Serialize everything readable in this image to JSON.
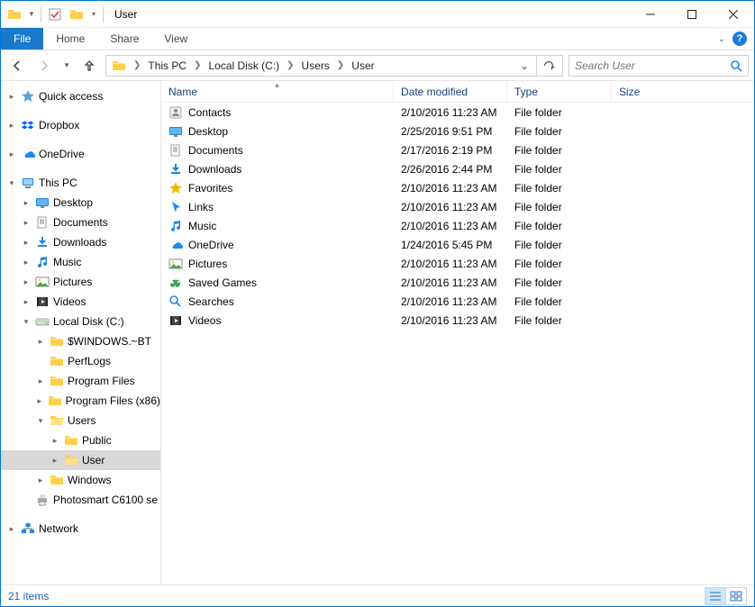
{
  "window": {
    "title": "User"
  },
  "ribbon": {
    "file": "File",
    "tabs": [
      "Home",
      "Share",
      "View"
    ]
  },
  "breadcrumbs": [
    "This PC",
    "Local Disk (C:)",
    "Users",
    "User"
  ],
  "search": {
    "placeholder": "Search User"
  },
  "columns": {
    "name": "Name",
    "date": "Date modified",
    "type": "Type",
    "size": "Size"
  },
  "tree": {
    "quick_access": "Quick access",
    "dropbox": "Dropbox",
    "onedrive": "OneDrive",
    "this_pc": "This PC",
    "desktop": "Desktop",
    "documents": "Documents",
    "downloads": "Downloads",
    "music": "Music",
    "pictures": "Pictures",
    "videos": "Videos",
    "local_disk": "Local Disk (C:)",
    "windows_bt": "$WINDOWS.~BT",
    "perflogs": "PerfLogs",
    "program_files": "Program Files",
    "program_files_x86": "Program Files (x86)",
    "users": "Users",
    "public": "Public",
    "user": "User",
    "windows": "Windows",
    "photosmart": "Photosmart C6100 se",
    "network": "Network"
  },
  "items": [
    {
      "name": "Contacts",
      "date": "2/10/2016 11:23 AM",
      "type": "File folder",
      "icon": "contacts"
    },
    {
      "name": "Desktop",
      "date": "2/25/2016 9:51 PM",
      "type": "File folder",
      "icon": "desktop"
    },
    {
      "name": "Documents",
      "date": "2/17/2016 2:19 PM",
      "type": "File folder",
      "icon": "documents"
    },
    {
      "name": "Downloads",
      "date": "2/26/2016 2:44 PM",
      "type": "File folder",
      "icon": "downloads"
    },
    {
      "name": "Favorites",
      "date": "2/10/2016 11:23 AM",
      "type": "File folder",
      "icon": "favorites"
    },
    {
      "name": "Links",
      "date": "2/10/2016 11:23 AM",
      "type": "File folder",
      "icon": "links"
    },
    {
      "name": "Music",
      "date": "2/10/2016 11:23 AM",
      "type": "File folder",
      "icon": "music"
    },
    {
      "name": "OneDrive",
      "date": "1/24/2016 5:45 PM",
      "type": "File folder",
      "icon": "onedrive"
    },
    {
      "name": "Pictures",
      "date": "2/10/2016 11:23 AM",
      "type": "File folder",
      "icon": "pictures"
    },
    {
      "name": "Saved Games",
      "date": "2/10/2016 11:23 AM",
      "type": "File folder",
      "icon": "games"
    },
    {
      "name": "Searches",
      "date": "2/10/2016 11:23 AM",
      "type": "File folder",
      "icon": "searches"
    },
    {
      "name": "Videos",
      "date": "2/10/2016 11:23 AM",
      "type": "File folder",
      "icon": "videos"
    }
  ],
  "status": {
    "count": "21 items"
  }
}
